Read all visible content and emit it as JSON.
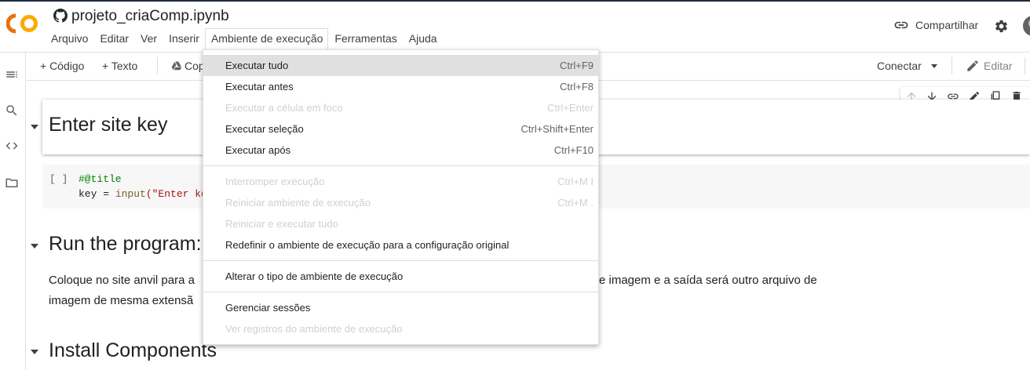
{
  "header": {
    "title": "projeto_criaComp.ipynb",
    "menu": [
      "Arquivo",
      "Editar",
      "Ver",
      "Inserir",
      "Ambiente de execução",
      "Ferramentas",
      "Ajuda"
    ],
    "share_label": "Compartilhar"
  },
  "toolbar": {
    "code_label": "+ Código",
    "text_label": "+ Texto",
    "copy_label_partial": "Cop",
    "connect_label": "Conectar",
    "edit_label": "Editar"
  },
  "notebook": {
    "heading1": "Enter site key",
    "code_bracket": "[ ]",
    "code_line1": "#@title",
    "code_line2_kw": "key = ",
    "code_line2_fn": "input",
    "code_line2_str": "(\"Enter ke",
    "heading2": "Run the program:",
    "para_line1_left": "Coloque no site anvil para a",
    "para_line1_right": "e imagem e a saída será outro arquivo de",
    "para_line2": "imagem de mesma extensã",
    "heading3": "Install Components"
  },
  "dropdown": {
    "items": [
      {
        "label": "Executar tudo",
        "shortcut": "Ctrl+F9",
        "disabled": false,
        "highlighted": true
      },
      {
        "label": "Executar antes",
        "shortcut": "Ctrl+F8",
        "disabled": false
      },
      {
        "label": "Executar a célula em foco",
        "shortcut": "Ctrl+Enter",
        "disabled": true
      },
      {
        "label": "Executar seleção",
        "shortcut": "Ctrl+Shift+Enter",
        "disabled": false
      },
      {
        "label": "Executar após",
        "shortcut": "Ctrl+F10",
        "disabled": false
      },
      {
        "label": "Interromper execução",
        "shortcut": "Ctrl+M I",
        "disabled": true
      },
      {
        "label": "Reiniciar ambiente de execução",
        "shortcut": "Ctrl+M .",
        "disabled": true
      },
      {
        "label": "Reiniciar e executar tudo",
        "shortcut": "",
        "disabled": true
      },
      {
        "label": "Redefinir o ambiente de execução para a configuração original",
        "shortcut": "",
        "disabled": false
      },
      {
        "label": "Alterar o tipo de ambiente de execução",
        "shortcut": "",
        "disabled": false
      },
      {
        "label": "Gerenciar sessões",
        "shortcut": "",
        "disabled": false
      },
      {
        "label": "Ver registros do ambiente de execução",
        "shortcut": "",
        "disabled": true
      }
    ]
  },
  "colors": {
    "logo_orange": "#f9ab00",
    "logo_dark_orange": "#e8710a",
    "code_green": "#008000",
    "code_func": "#795e26",
    "code_string": "#a31515"
  }
}
